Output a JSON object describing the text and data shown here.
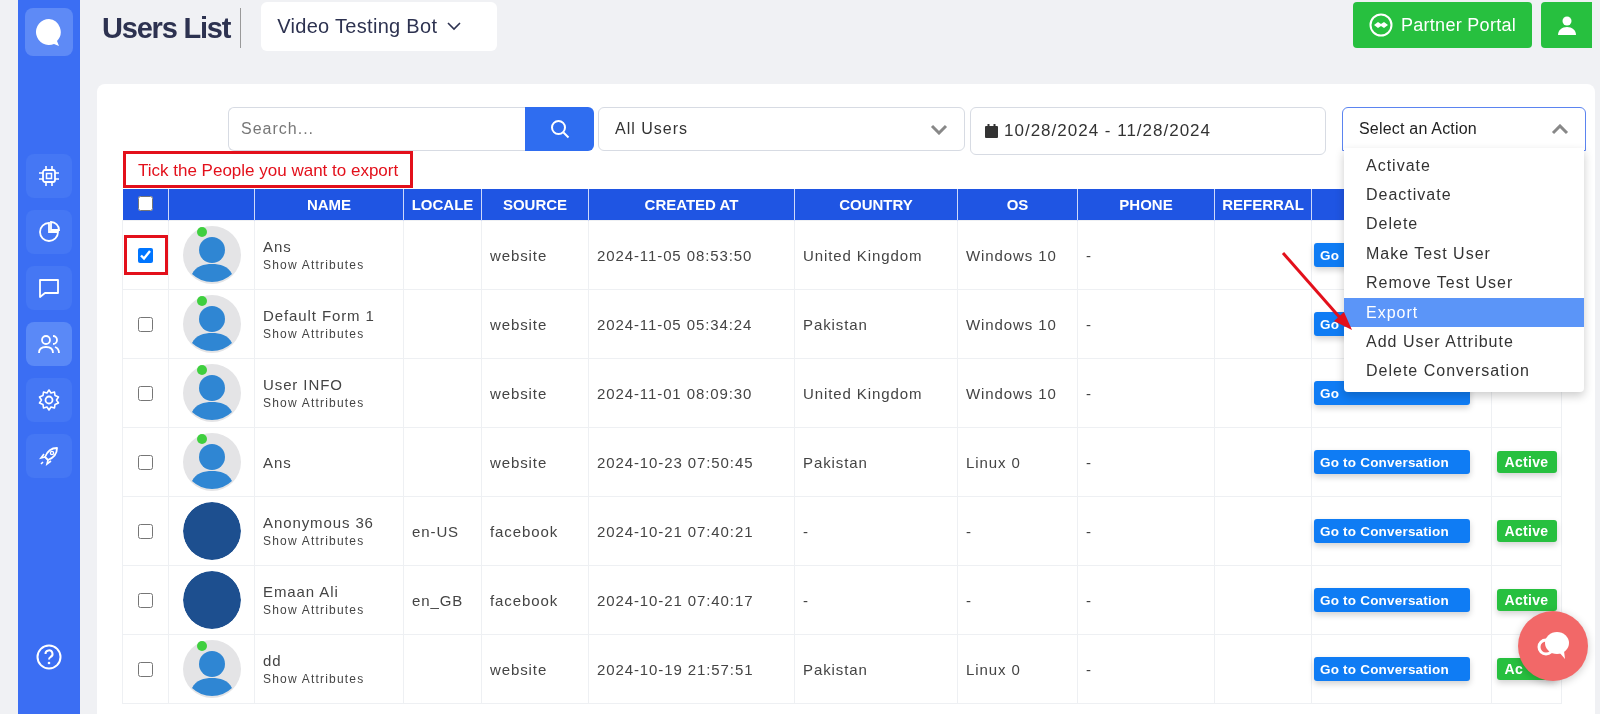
{
  "sidebar": {
    "items": [
      {
        "selected": false
      },
      {
        "selected": false
      },
      {
        "selected": false
      },
      {
        "selected": true
      },
      {
        "selected": false
      },
      {
        "selected": false
      }
    ]
  },
  "header": {
    "title": "Users List",
    "bot_selector": {
      "value": "Video Testing Bot"
    },
    "partner_button": "Partner Portal"
  },
  "filters": {
    "search": {
      "placeholder": "Search..."
    },
    "user_filter": {
      "value": "All Users"
    },
    "date_range": {
      "value": "10/28/2024 - 11/28/2024"
    },
    "action_select": {
      "value": "Select an Action",
      "expanded": true,
      "options": [
        {
          "label": "Activate",
          "selected": false
        },
        {
          "label": "Deactivate",
          "selected": false
        },
        {
          "label": "Delete",
          "selected": false
        },
        {
          "label": "Make Test User",
          "selected": false
        },
        {
          "label": "Remove Test User",
          "selected": false
        },
        {
          "label": "Export",
          "selected": true
        },
        {
          "label": "Add User Attribute",
          "selected": false
        },
        {
          "label": "Delete Conversation",
          "selected": false
        }
      ]
    }
  },
  "annotation": {
    "note": "Tick the People you want to export"
  },
  "table": {
    "select_all": {
      "checked": false
    },
    "columns": [
      "NAME",
      "LOCALE",
      "SOURCE",
      "CREATED AT",
      "COUNTRY",
      "OS",
      "PHONE",
      "REFERRAL"
    ],
    "rows": [
      {
        "checked": true,
        "highlighted": true,
        "avatar": {
          "kind": "default",
          "online": true
        },
        "name": "Ans",
        "show_attributes": "Show Attributes",
        "source": "website",
        "created_at": "2024-11-05 08:53:50",
        "country": "United Kingdom",
        "os": "Windows 10",
        "phone": "-",
        "action": "Go"
      },
      {
        "checked": false,
        "highlighted": false,
        "avatar": {
          "kind": "default",
          "online": true
        },
        "name": "Default Form 1",
        "show_attributes": "Show Attributes",
        "source": "website",
        "created_at": "2024-11-05 05:34:24",
        "country": "Pakistan",
        "os": "Windows 10",
        "phone": "-",
        "action": "Go"
      },
      {
        "checked": false,
        "highlighted": false,
        "avatar": {
          "kind": "default",
          "online": true
        },
        "name": "User INFO",
        "show_attributes": "Show Attributes",
        "source": "website",
        "created_at": "2024-11-01 08:09:30",
        "country": "United Kingdom",
        "os": "Windows 10",
        "phone": "-",
        "action": "Go"
      },
      {
        "checked": false,
        "highlighted": false,
        "avatar": {
          "kind": "default",
          "online": true
        },
        "name": "Ans",
        "source": "website",
        "created_at": "2024-10-23 07:50:45",
        "country": "Pakistan",
        "os": "Linux 0",
        "phone": "-",
        "action": "Go to Conversation",
        "status": "Active"
      },
      {
        "checked": false,
        "highlighted": false,
        "avatar": {
          "kind": "photo",
          "online": false
        },
        "name": "Anonymous 36",
        "show_attributes": "Show Attributes",
        "locale": "en-US",
        "source": "facebook",
        "created_at": "2024-10-21 07:40:21",
        "country": "-",
        "os": "-",
        "phone": "-",
        "action": "Go to Conversation",
        "status": "Active"
      },
      {
        "checked": false,
        "highlighted": false,
        "avatar": {
          "kind": "photo",
          "online": false
        },
        "name": "Emaan Ali",
        "show_attributes": "Show Attributes",
        "locale": "en_GB",
        "source": "facebook",
        "created_at": "2024-10-21 07:40:17",
        "country": "-",
        "os": "-",
        "phone": "-",
        "action": "Go to Conversation",
        "status": "Active"
      },
      {
        "checked": false,
        "highlighted": false,
        "avatar": {
          "kind": "default",
          "online": true
        },
        "name": "dd",
        "show_attributes": "Show Attributes",
        "source": "website",
        "created_at": "2024-10-19 21:57:51",
        "country": "Pakistan",
        "os": "Linux 0",
        "phone": "-",
        "action": "Go to Conversation",
        "status": "Ac"
      }
    ]
  }
}
